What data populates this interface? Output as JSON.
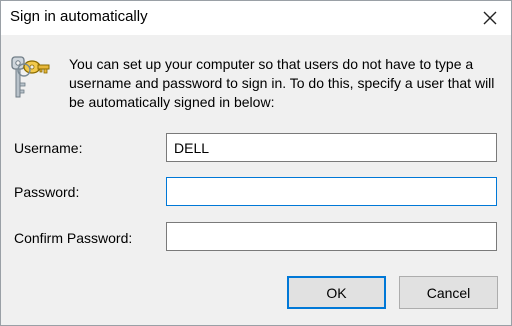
{
  "window": {
    "title": "Sign in automatically",
    "close_icon": "close-icon"
  },
  "description": "You can set up your computer so that users do not have to type a username and password to sign in. To do this, specify a user that will be automatically signed in below:",
  "form": {
    "username_label": "Username:",
    "username_value": "DELL",
    "password_label": "Password:",
    "password_value": "",
    "confirm_label": "Confirm Password:",
    "confirm_value": ""
  },
  "buttons": {
    "ok": "OK",
    "cancel": "Cancel"
  },
  "colors": {
    "focus_border": "#0078d7",
    "dialog_bg": "#f0f0f0"
  },
  "icons": [
    "keys-icon",
    "close-icon"
  ]
}
